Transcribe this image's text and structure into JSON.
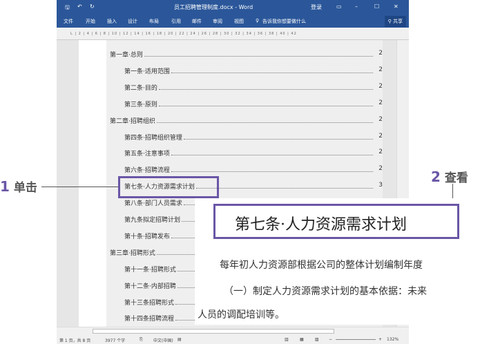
{
  "title": "员工招聘管理制度.docx - Word",
  "login": "登录",
  "tabs": [
    "文件",
    "开始",
    "插入",
    "设计",
    "布局",
    "引用",
    "邮件",
    "审阅",
    "视图"
  ],
  "tell_me": "告诉我你想要做什么",
  "share": "共享",
  "ruler": "L  |  2  |  4  |  6  |  8  |  10  |  12  |  14  |  16  |  18  |  20  |  22  |  24  |  26  |  28  |  30  |  32  |  34  |  36  |  38  |  40  |  42",
  "toc": [
    {
      "text": "第一章·总则",
      "page": "2",
      "level": 1
    },
    {
      "text": "第一条·适用范围",
      "page": "2",
      "level": 2
    },
    {
      "text": "第二条·目的",
      "page": "2",
      "level": 2
    },
    {
      "text": "第三条·原则",
      "page": "2",
      "level": 2
    },
    {
      "text": "第二章·招聘组织",
      "page": "2",
      "level": 1
    },
    {
      "text": "第四条·招聘组织管理",
      "page": "2",
      "level": 2
    },
    {
      "text": "第五条·注意事项",
      "page": "2",
      "level": 2
    },
    {
      "text": "第六条·招聘流程",
      "page": "2",
      "level": 2
    },
    {
      "text": "第七条·人力资源需求计划",
      "page": "3",
      "level": 2
    },
    {
      "text": "第八条·部门人员需求",
      "level": 2
    },
    {
      "text": "第九条拟定招聘计划",
      "level": 2
    },
    {
      "text": "第十条·招聘发布",
      "level": 2
    },
    {
      "text": "第三章·招聘形式",
      "level": 1
    },
    {
      "text": "第十一条·招聘形式",
      "level": 2
    },
    {
      "text": "第十二条·内部招聘",
      "level": 2
    },
    {
      "text": "第十三条招聘形式",
      "level": 2
    },
    {
      "text": "第十四条招聘流程",
      "level": 2
    }
  ],
  "status": {
    "page": "第 1 页，共 8 页",
    "words": "3977 个字",
    "lang": "中文(中国)",
    "zoom": "132%"
  },
  "callouts": {
    "step1_num": "1",
    "step1": "单击",
    "step2_num": "2",
    "step2": "查看"
  },
  "zoom_panel": {
    "heading": "第七条·人力资源需求计划",
    "line1": "每年初人力资源部根据公司的整体计划编制年度",
    "line2": "（一）制定人力资源需求计划的基本依据：未来",
    "line3": "人员的调配培训等。"
  },
  "colors": {
    "accent": "#2b579a",
    "callout": "#6a56a6"
  }
}
